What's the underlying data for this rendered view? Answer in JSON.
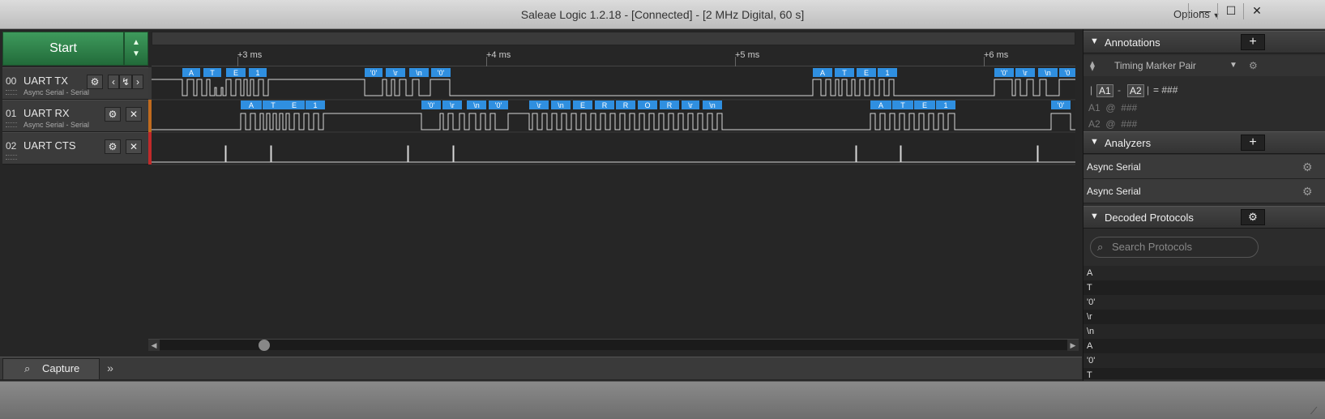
{
  "window": {
    "title": "Saleae Logic 1.2.18 - [Connected] - [2 MHz Digital, 60 s]",
    "options_label": "Options",
    "minimize": "—",
    "maximize": "☐",
    "close": "✕"
  },
  "toolbar": {
    "start_label": "Start"
  },
  "ruler": {
    "ticks": [
      "+3 ms",
      "+4 ms",
      "+5 ms",
      "+6 ms"
    ]
  },
  "channels": [
    {
      "num": "00",
      "name": "UART TX",
      "sub": "Async Serial - Serial"
    },
    {
      "num": "01",
      "name": "UART RX",
      "sub": "Async Serial - Serial"
    },
    {
      "num": "02",
      "name": "UART CTS",
      "sub": ""
    }
  ],
  "decodes": {
    "tx": [
      "A",
      "T",
      "E",
      "1",
      "'0'",
      "\\r",
      "\\n",
      "'0'",
      "A",
      "T",
      "E",
      "1",
      "'0'",
      "\\r",
      "\\n",
      "'0"
    ],
    "rx": [
      "A",
      "T",
      "E",
      "1",
      "'0'",
      "\\r",
      "\\n",
      "'0'",
      "\\r",
      "\\n",
      "E",
      "R",
      "R",
      "O",
      "R",
      "\\r",
      "\\n",
      "A",
      "T",
      "E",
      "1",
      "'0'"
    ]
  },
  "tabs": {
    "capture_label": "Capture",
    "more_label": "»"
  },
  "annotations": {
    "title": "Annotations",
    "add_label": "+",
    "marker_label": "Timing Marker Pair",
    "a1": "A1",
    "a2": "A2",
    "pair_value": "= ###",
    "a1_row": "A1  @  ###",
    "a2_row": "A2  @  ###"
  },
  "analyzers": {
    "title": "Analyzers",
    "add_label": "+",
    "items": [
      "Async Serial",
      "Async Serial"
    ]
  },
  "decoded_protocols": {
    "title": "Decoded Protocols",
    "search_placeholder": "Search Protocols",
    "items": [
      "A",
      "T",
      "'0'",
      "\\r",
      "\\n",
      "A",
      "'0'",
      "T"
    ]
  }
}
